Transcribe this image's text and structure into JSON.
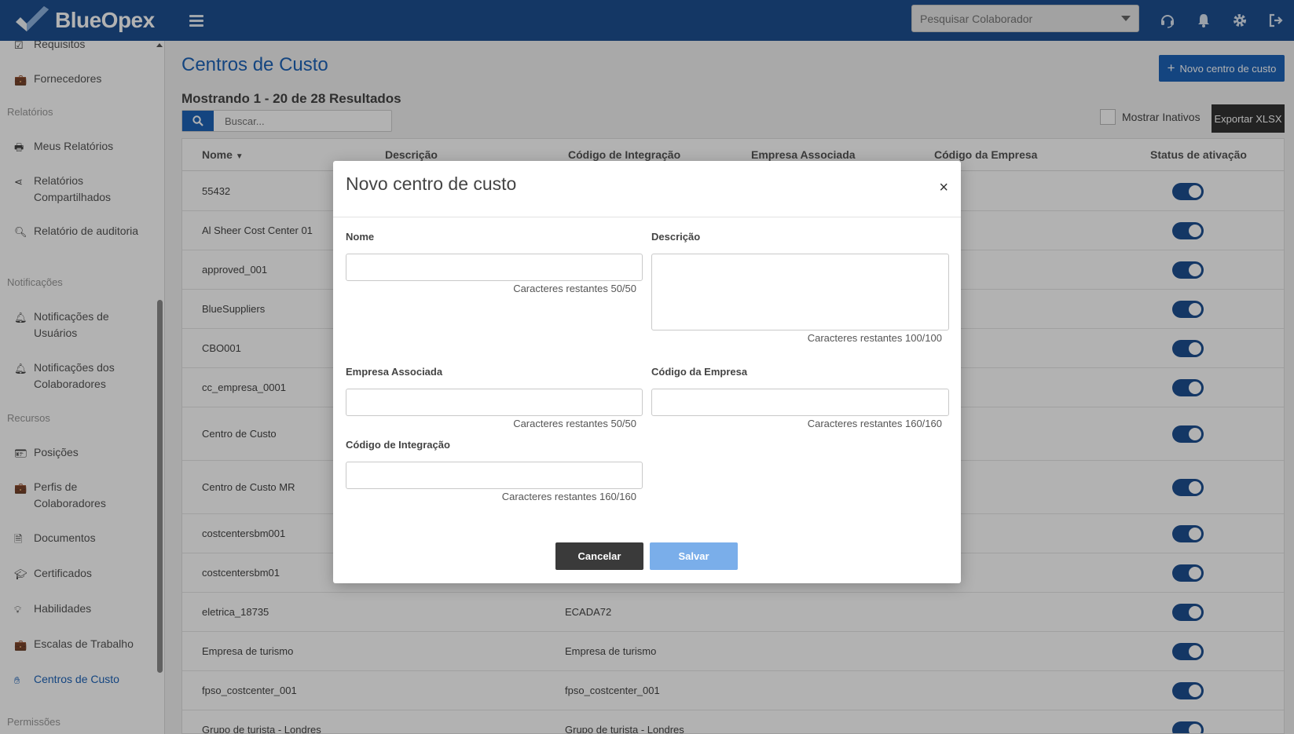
{
  "app": {
    "brand": "BlueOpex"
  },
  "topbar": {
    "search_placeholder": "Pesquisar Colaborador",
    "icons": [
      "headset-icon",
      "bell-icon",
      "gear-icon",
      "logout-icon"
    ]
  },
  "sidebar": {
    "items_top": [
      {
        "label": "Requisitos",
        "icon": "checkbox-icon"
      },
      {
        "label": "Fornecedores",
        "icon": "briefcase-icon"
      }
    ],
    "sections": {
      "relatorios": "Relatórios",
      "notificacoes": "Notificações",
      "recursos": "Recursos",
      "permissoes": "Permissões"
    },
    "relatorios": [
      {
        "label": "Meus Relatórios",
        "icon": "print-icon"
      },
      {
        "label": "Relatórios Compartilhados",
        "icon": "share-icon"
      },
      {
        "label": "Relatório de auditoria",
        "icon": "search-icon"
      }
    ],
    "notificacoes": [
      {
        "label": "Notificações de Usuários",
        "icon": "bell-icon"
      },
      {
        "label": "Notificações dos Colaboradores",
        "icon": "bell-icon"
      }
    ],
    "recursos": [
      {
        "label": "Posições",
        "icon": "id-card-icon"
      },
      {
        "label": "Perfis de Colaboradores",
        "icon": "briefcase-icon"
      },
      {
        "label": "Documentos",
        "icon": "document-icon"
      },
      {
        "label": "Certificados",
        "icon": "graduation-cap-icon"
      },
      {
        "label": "Habilidades",
        "icon": "lightbulb-icon"
      },
      {
        "label": "Escalas de Trabalho",
        "icon": "briefcase-clock-icon"
      },
      {
        "label": "Centros de Custo",
        "icon": "hand-coin-icon"
      }
    ]
  },
  "main": {
    "title": "Centros de Custo",
    "new_button": "Novo centro de custo",
    "results_text": "Mostrando 1 - 20 de 28 Resultados",
    "search_placeholder": "Buscar...",
    "show_inactive": "Mostrar Inativos",
    "export_button": "Exportar XLSX",
    "columns": [
      "Nome",
      "Descrição",
      "Código de Integração",
      "Empresa Associada",
      "Código da Empresa",
      "Status de ativação"
    ],
    "rows": [
      {
        "nome": "55432",
        "codigo": "",
        "active": true
      },
      {
        "nome": "Al Sheer Cost Center 01",
        "codigo": "",
        "active": true
      },
      {
        "nome": "approved_001",
        "codigo": "",
        "active": true
      },
      {
        "nome": "BlueSuppliers",
        "codigo": "",
        "active": true
      },
      {
        "nome": "CBO001",
        "codigo": "",
        "active": true
      },
      {
        "nome": "cc_empresa_0001",
        "codigo": "",
        "active": true
      },
      {
        "nome": "Centro de Custo",
        "codigo": "",
        "active": true
      },
      {
        "nome": "Centro de Custo MR",
        "codigo": "",
        "active": true
      },
      {
        "nome": "costcentersbm001",
        "codigo": "",
        "active": true
      },
      {
        "nome": "costcentersbm01",
        "codigo": "",
        "active": true
      },
      {
        "nome": "eletrica_18735",
        "codigo": "ECADA72",
        "active": true
      },
      {
        "nome": "Empresa de turismo",
        "codigo": "Empresa de turismo",
        "active": true
      },
      {
        "nome": "fpso_costcenter_001",
        "codigo": "fpso_costcenter_001",
        "active": true
      },
      {
        "nome": "Grupo de turista - Londres",
        "codigo": "Grupo de turista - Londres",
        "active": true
      }
    ]
  },
  "modal": {
    "title": "Novo centro de custo",
    "close": "×",
    "fields": {
      "nome": {
        "label": "Nome",
        "value": "",
        "hint": "Caracteres restantes 50/50"
      },
      "descricao": {
        "label": "Descrição",
        "value": "",
        "hint": "Caracteres restantes 100/100"
      },
      "empresa": {
        "label": "Empresa Associada",
        "value": "",
        "hint": "Caracteres restantes 50/50"
      },
      "codigo_empresa": {
        "label": "Código da Empresa",
        "value": "",
        "hint": "Caracteres restantes 160/160"
      },
      "codigo_integracao": {
        "label": "Código de Integração",
        "value": "",
        "hint": "Caracteres restantes 160/160"
      }
    },
    "cancel": "Cancelar",
    "save": "Salvar"
  },
  "colors": {
    "brand": "#1d4f91",
    "accent": "#1d63b8",
    "save_disabled": "#7aaeea"
  }
}
